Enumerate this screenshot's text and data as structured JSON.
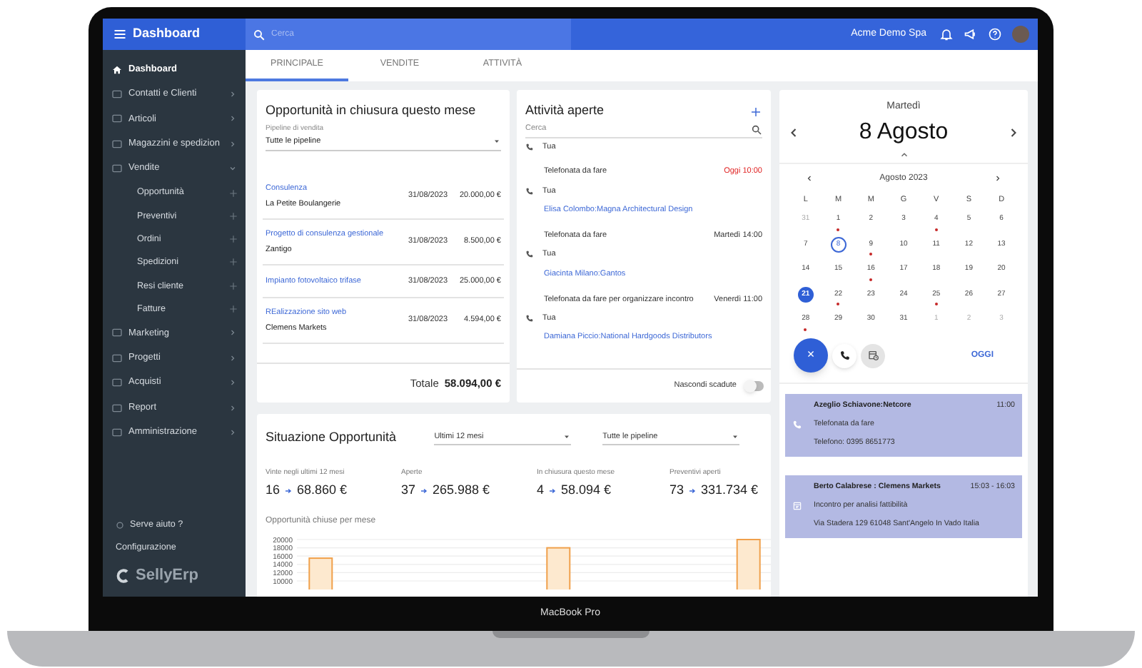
{
  "header": {
    "title": "Dashboard",
    "search_placeholder": "Cerca",
    "company": "Acme Demo Spa"
  },
  "sidebar": {
    "items": [
      {
        "label": "Dashboard",
        "selected": true
      },
      {
        "label": "Contatti e Clienti",
        "selected": false,
        "expanded": false
      },
      {
        "label": "Articoli",
        "selected": false,
        "expanded": false
      },
      {
        "label": "Magazzini e spedizion",
        "selected": false,
        "expanded": false
      },
      {
        "label": "Vendite",
        "selected": false,
        "expanded": true,
        "children": [
          {
            "label": "Opportunità"
          },
          {
            "label": "Preventivi"
          },
          {
            "label": "Ordini"
          },
          {
            "label": "Spedizioni"
          },
          {
            "label": "Resi cliente"
          },
          {
            "label": "Fatture"
          }
        ]
      },
      {
        "label": "Marketing",
        "selected": false,
        "expanded": false
      },
      {
        "label": "Progetti",
        "selected": false,
        "expanded": false
      },
      {
        "label": "Acquisti",
        "selected": false,
        "expanded": false
      },
      {
        "label": "Report",
        "selected": false,
        "expanded": false
      },
      {
        "label": "Amministrazione",
        "selected": false,
        "expanded": false
      }
    ],
    "help": "Serve aiuto ?",
    "settings": "Configurazione",
    "logo": "SellyErp"
  },
  "tabs": [
    {
      "label": "PRINCIPALE",
      "selected": true
    },
    {
      "label": "VENDITE",
      "selected": false
    },
    {
      "label": "ATTIVITÀ",
      "selected": false
    }
  ],
  "opportunities": {
    "title": "Opportunità in chiusura questo mese",
    "pipeline_label": "Pipeline di vendita",
    "pipeline_value": "Tutte le pipeline",
    "rows": [
      {
        "title": "Consulenza",
        "company": "La Petite Boulangerie",
        "date": "31/08/2023",
        "amount": "20.000,00 €"
      },
      {
        "title": "Progetto di consulenza gestionale",
        "company": "Zantigo",
        "date": "31/08/2023",
        "amount": "8.500,00 €"
      },
      {
        "title": "Impianto fotovoltaico trifase",
        "date": "31/08/2023",
        "amount": "25.000,00 €"
      },
      {
        "title": "REalizzazione sito web",
        "company": "Clemens Markets",
        "date": "31/08/2023",
        "amount": "4.594,00 €"
      }
    ],
    "total_label": "Totale",
    "total": "58.094,00 €"
  },
  "activities": {
    "title": "Attività aperte",
    "search_placeholder": "Cerca",
    "items": [
      {
        "owner": "Tua"
      },
      {
        "title": "Telefonata da fare",
        "time": "Oggi 10:00",
        "overdue": true,
        "owner": "Tua",
        "contact": "Elisa Colombo:Magna Architectural Design"
      },
      {
        "title": "Telefonata da fare",
        "time": "Martedì 14:00",
        "overdue": false,
        "owner": "Tua",
        "contact": "Giacinta Milano:Gantos"
      },
      {
        "title": "Telefonata da fare per organizzare incontro",
        "time": "Venerdì 11:00",
        "overdue": false,
        "owner": "Tua",
        "contact": "Damiana Piccio:National Hardgoods Distributors"
      }
    ],
    "toggle": {
      "label": "Nascondi scadute",
      "on": false
    }
  },
  "situation": {
    "title": "Situazione Opportunità",
    "period": "Ultimi 12 mesi",
    "pipeline": "Tutte le pipeline",
    "stats": [
      {
        "label": "Vinte negli ultimi 12 mesi",
        "count": "16",
        "amount": "68.860 €"
      },
      {
        "label": "Aperte",
        "count": "37",
        "amount": "265.988 €"
      },
      {
        "label": "In chiusura questo mese",
        "count": "4",
        "amount": "58.094 €"
      },
      {
        "label": "Preventivi aperti",
        "count": "73",
        "amount": "331.734 €"
      }
    ],
    "chart_title": "Opportunità chiuse per mese",
    "chart_data": {
      "type": "bar",
      "grid": true,
      "ylim": [
        10000,
        20000
      ],
      "yticks": [
        10000,
        12000,
        14000,
        16000,
        18000,
        20000
      ],
      "series": [
        {
          "color": "#fde9cf",
          "values": [
            15500,
            null,
            null,
            null,
            null,
            18000,
            null,
            null,
            null,
            20000
          ]
        }
      ]
    }
  },
  "calendar": {
    "weekday": "Martedì",
    "date": "8 Agosto",
    "month": "Agosto 2023",
    "day_names": [
      "L",
      "M",
      "M",
      "G",
      "V",
      "S",
      "D"
    ],
    "weeks": [
      [
        {
          "label": "31",
          "outside": true,
          "event": false,
          "today": false,
          "selected": false
        },
        {
          "label": "1",
          "outside": false,
          "event": true,
          "today": false,
          "selected": false
        },
        {
          "label": "2",
          "outside": false,
          "event": false,
          "today": false,
          "selected": false
        },
        {
          "label": "3",
          "outside": false,
          "event": false,
          "today": false,
          "selected": false
        },
        {
          "label": "4",
          "outside": false,
          "event": true,
          "today": false,
          "selected": false
        },
        {
          "label": "5",
          "outside": false,
          "event": false,
          "today": false,
          "selected": false
        },
        {
          "label": "6",
          "outside": false,
          "event": false,
          "today": false,
          "selected": false
        }
      ],
      [
        {
          "label": "7",
          "outside": false,
          "event": false,
          "today": false,
          "selected": false
        },
        {
          "label": "8",
          "outside": false,
          "event": false,
          "today": true,
          "selected": false
        },
        {
          "label": "9",
          "outside": false,
          "event": true,
          "today": false,
          "selected": false
        },
        {
          "label": "10",
          "outside": false,
          "event": false,
          "today": false,
          "selected": false
        },
        {
          "label": "11",
          "outside": false,
          "event": false,
          "today": false,
          "selected": false
        },
        {
          "label": "12",
          "outside": false,
          "event": false,
          "today": false,
          "selected": false
        },
        {
          "label": "13",
          "outside": false,
          "event": false,
          "today": false,
          "selected": false
        }
      ],
      [
        {
          "label": "14",
          "outside": false,
          "event": false,
          "today": false,
          "selected": false
        },
        {
          "label": "15",
          "outside": false,
          "event": false,
          "today": false,
          "selected": false
        },
        {
          "label": "16",
          "outside": false,
          "event": true,
          "today": false,
          "selected": false
        },
        {
          "label": "17",
          "outside": false,
          "event": false,
          "today": false,
          "selected": false
        },
        {
          "label": "18",
          "outside": false,
          "event": false,
          "today": false,
          "selected": false
        },
        {
          "label": "19",
          "outside": false,
          "event": false,
          "today": false,
          "selected": false
        },
        {
          "label": "20",
          "outside": false,
          "event": false,
          "today": false,
          "selected": false
        }
      ],
      [
        {
          "label": "21",
          "outside": false,
          "event": false,
          "today": false,
          "selected": true
        },
        {
          "label": "22",
          "outside": false,
          "event": true,
          "today": false,
          "selected": false
        },
        {
          "label": "23",
          "outside": false,
          "event": false,
          "today": false,
          "selected": false
        },
        {
          "label": "24",
          "outside": false,
          "event": false,
          "today": false,
          "selected": false
        },
        {
          "label": "25",
          "outside": false,
          "event": true,
          "today": false,
          "selected": false
        },
        {
          "label": "26",
          "outside": false,
          "event": false,
          "today": false,
          "selected": false
        },
        {
          "label": "27",
          "outside": false,
          "event": false,
          "today": false,
          "selected": false
        }
      ],
      [
        {
          "label": "28",
          "outside": false,
          "event": true,
          "today": false,
          "selected": false
        },
        {
          "label": "29",
          "outside": false,
          "event": false,
          "today": false,
          "selected": false
        },
        {
          "label": "30",
          "outside": false,
          "event": false,
          "today": false,
          "selected": false
        },
        {
          "label": "31",
          "outside": false,
          "event": false,
          "today": false,
          "selected": false
        },
        {
          "label": "1",
          "outside": true,
          "event": false,
          "today": false,
          "selected": false
        },
        {
          "label": "2",
          "outside": true,
          "event": false,
          "today": false,
          "selected": false
        },
        {
          "label": "3",
          "outside": true,
          "event": false,
          "today": false,
          "selected": false
        }
      ]
    ],
    "close_label": "×",
    "today_button": "OGGI",
    "events": [
      {
        "kind": "call",
        "title": "Azeglio Schiavone:Netcore",
        "time": "11:00",
        "line1": "Telefonata da fare",
        "line2": "Telefono: 0395 8651773"
      },
      {
        "kind": "meeting",
        "title": "Berto Calabrese : Clemens Markets",
        "time": "15:03 - 16:03",
        "line1": "Incontro per analisi fattibilità",
        "line2": "Via Stadera 129 61048 Sant'Angelo In Vado Italia"
      }
    ]
  },
  "device_label": "MacBook Pro"
}
